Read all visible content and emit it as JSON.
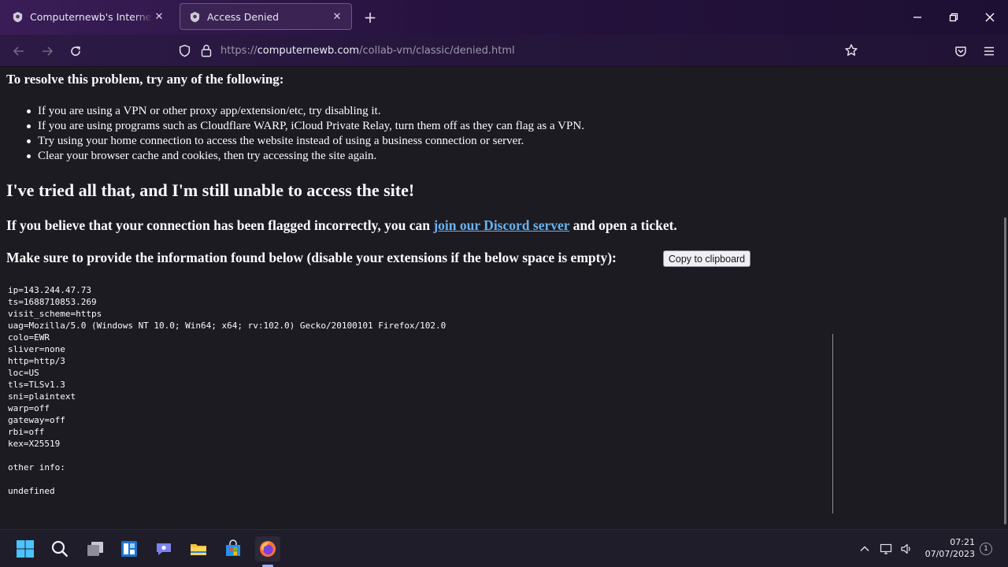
{
  "browser": {
    "tabs": [
      {
        "label": "Computernewb's Internet Pub Hub",
        "icon": "collabvm-favicon-icon",
        "active": false
      },
      {
        "label": "Access Denied",
        "icon": "collabvm-favicon-icon",
        "active": true
      }
    ],
    "new_tab_symbol": "+",
    "url": {
      "scheme": "https://",
      "host": "computernewb.com",
      "path": "/collab-vm/classic/denied.html"
    }
  },
  "page": {
    "resolve_heading": "To resolve this problem, try any of the following:",
    "tips": [
      "If you are using a VPN or other proxy app/extension/etc, try disabling it.",
      "If you are using programs such as Cloudflare WARP, iCloud Private Relay, turn them off as they can flag as a VPN.",
      "Try using your home connection to access the website instead of using a business connection or server.",
      "Clear your browser cache and cookies, then try accessing the site again."
    ],
    "still_heading": "I've tried all that, and I'm still unable to access the site!",
    "flagged_prefix": "If you believe that your connection has been flagged incorrectly, you can ",
    "discord_link": "join our Discord server",
    "flagged_suffix": " and open a ticket.",
    "provide_heading": "Make sure to provide the information found below (disable your extensions if the below space is empty):",
    "copy_button": "Copy to clipboard",
    "info_lines": [
      "ip=143.244.47.73",
      "ts=1688710853.269",
      "visit_scheme=https",
      "uag=Mozilla/5.0 (Windows NT 10.0; Win64; x64; rv:102.0) Gecko/20100101 Firefox/102.0",
      "colo=EWR",
      "sliver=none",
      "http=http/3",
      "loc=US",
      "tls=TLSv1.3",
      "sni=plaintext",
      "warp=off",
      "gateway=off",
      "rbi=off",
      "kex=X25519",
      "",
      "other info:",
      "",
      "undefined"
    ]
  },
  "taskbar": {
    "apps": [
      "start-icon",
      "search-icon",
      "task-view-icon",
      "widgets-icon",
      "teams-chat-icon",
      "file-explorer-icon",
      "microsoft-store-icon",
      "firefox-icon"
    ],
    "clock_time": "07:21",
    "clock_date": "07/07/2023",
    "notification_count": "1"
  }
}
